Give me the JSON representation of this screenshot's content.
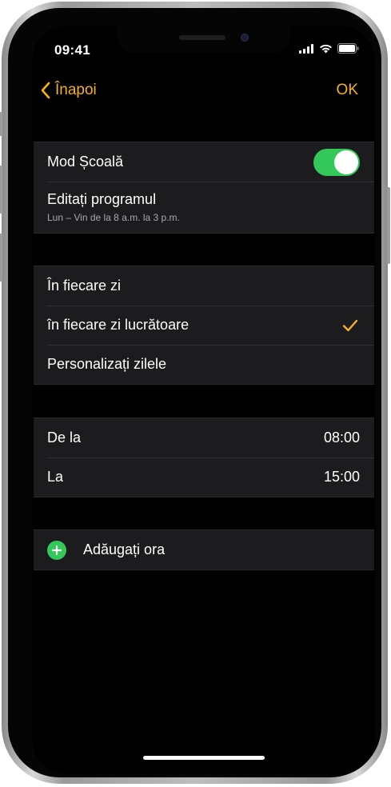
{
  "status_bar": {
    "time": "09:41"
  },
  "nav": {
    "back_label": "Înapoi",
    "done_label": "OK"
  },
  "school_mode": {
    "toggle_label": "Mod Școală",
    "toggle_on": true,
    "edit_schedule_label": "Editați programul",
    "schedule_summary": "Lun – Vin de la 8 a.m. la 3 p.m."
  },
  "repeat": {
    "options": [
      {
        "label": "În fiecare zi",
        "selected": false
      },
      {
        "label": "în fiecare zi lucrătoare",
        "selected": true
      },
      {
        "label": "Personalizați zilele",
        "selected": false
      }
    ]
  },
  "time_range": {
    "from_label": "De la",
    "from_value": "08:00",
    "to_label": "La",
    "to_value": "15:00"
  },
  "add_time": {
    "label": "Adăugați ora"
  },
  "colors": {
    "accent": "#f5b21b",
    "toggle_on": "#34c759",
    "add_icon": "#34c759",
    "row_background": "#1c1c1e",
    "background": "#000000"
  }
}
